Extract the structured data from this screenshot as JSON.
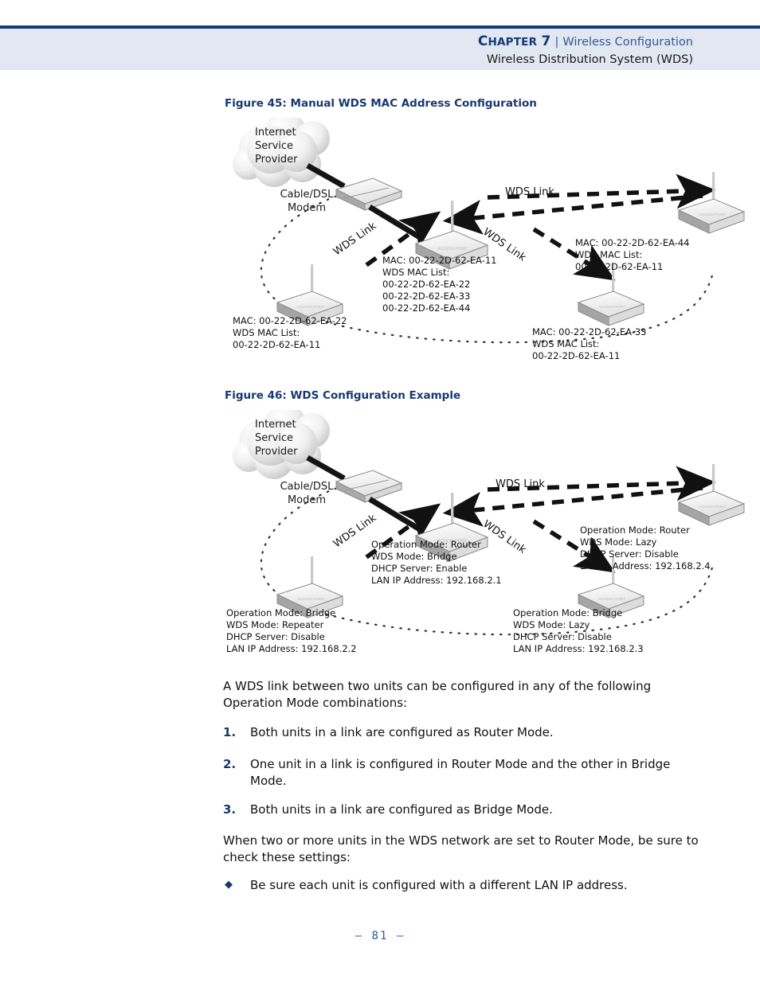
{
  "header": {
    "chapter_label": "Chapter",
    "chapter_number": "7",
    "separator": "|",
    "section": "Wireless Configuration",
    "subsection": "Wireless Distribution System (WDS)"
  },
  "figures": [
    {
      "caption": "Figure 45:  Manual WDS MAC Address Configuration",
      "cloud": {
        "line1": "Internet",
        "line2": "Service",
        "line3": "Provider"
      },
      "modem": {
        "line1": "Cable/DSL",
        "line2": "Modem"
      },
      "link_labels": {
        "top": "WDS Link",
        "left": "WDS Link",
        "right": "WDS Link"
      },
      "nodes": {
        "center": {
          "mac": "MAC: 00-22-2D-62-EA-11",
          "list_title": "WDS MAC List:",
          "list": [
            "00-22-2D-62-EA-22",
            "00-22-2D-62-EA-33",
            "00-22-2D-62-EA-44"
          ]
        },
        "left": {
          "mac": "MAC: 00-22-2D-62-EA-22",
          "list_title": "WDS MAC List:",
          "list": [
            "00-22-2D-62-EA-11"
          ]
        },
        "top_right": {
          "mac": "MAC: 00-22-2D-62-EA-44",
          "list_title": "WDS MAC List:",
          "list": [
            "00-22-2D-62-EA-11"
          ]
        },
        "bottom_right": {
          "mac": "MAC: 00-22-2D-62-EA-33",
          "list_title": "WDS MAC List:",
          "list": [
            "00-22-2D-62-EA-11"
          ]
        }
      }
    },
    {
      "caption": "Figure 46:  WDS Configuration Example",
      "cloud": {
        "line1": "Internet",
        "line2": "Service",
        "line3": "Provider"
      },
      "modem": {
        "line1": "Cable/DSL",
        "line2": "Modem"
      },
      "link_labels": {
        "top": "WDS Link",
        "left": "WDS Link",
        "right": "WDS Link"
      },
      "nodes": {
        "center": {
          "operation_mode": "Operation Mode: Router",
          "wds_mode": "WDS Mode: Bridge",
          "dhcp": "DHCP Server: Enable",
          "lan_ip": "LAN IP Address: 192.168.2.1"
        },
        "left": {
          "operation_mode": "Operation Mode: Bridge",
          "wds_mode": "WDS Mode: Repeater",
          "dhcp": "DHCP Server: Disable",
          "lan_ip": "LAN IP Address: 192.168.2.2"
        },
        "top_right": {
          "operation_mode": "Operation Mode: Router",
          "wds_mode": "WDS Mode: Lazy",
          "dhcp": "DHCP Server: Disable",
          "lan_ip": "LAN IP Address: 192.168.2.4"
        },
        "bottom_right": {
          "operation_mode": "Operation Mode: Bridge",
          "wds_mode": "WDS Mode: Lazy",
          "dhcp": "DHCP Server: Disable",
          "lan_ip": "LAN IP Address: 192.168.2.3"
        }
      }
    }
  ],
  "body": {
    "intro": "A WDS link between two units can be configured in any of the following Operation Mode combinations:",
    "numbered": [
      {
        "num": "1.",
        "text": "Both units in a link are configured as Router Mode."
      },
      {
        "num": "2.",
        "text": "One unit in a link is configured in Router Mode and the other in Bridge Mode."
      },
      {
        "num": "3.",
        "text": "Both units in a link are configured as Bridge Mode."
      }
    ],
    "note": "When two or more units in the WDS network are set to Router Mode, be sure to check these settings:",
    "bullet_glyph": "◆",
    "bullets": [
      "Be sure each unit is configured with a different LAN IP address."
    ]
  },
  "footer": {
    "page": "–  81  –"
  }
}
